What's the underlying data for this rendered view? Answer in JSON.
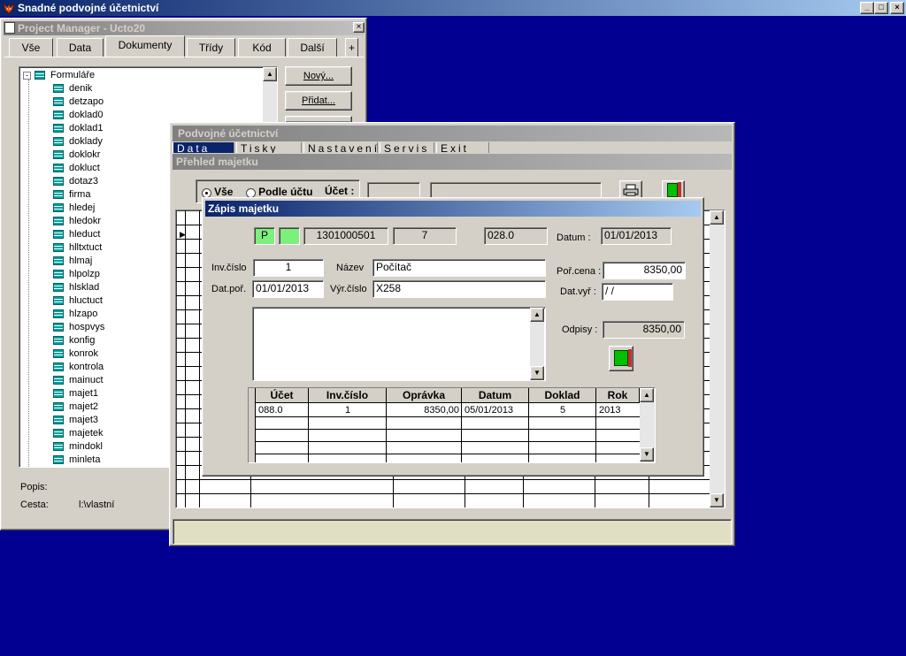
{
  "main_window": {
    "title": "Snadné podvojné účetnictví"
  },
  "project_manager": {
    "title": "Project Manager - Ucto20",
    "tabs": [
      "Vše",
      "Data",
      "Dokumenty",
      "Třídy",
      "Kód",
      "Další"
    ],
    "tab_more": "+",
    "tree_root": "Formuláře",
    "tree_items": [
      "denik",
      "detzapo",
      "doklad0",
      "doklad1",
      "doklady",
      "doklokr",
      "dokluct",
      "dotaz3",
      "firma",
      "hledej",
      "hledokr",
      "hleduct",
      "hlltxtuct",
      "hlmaj",
      "hlpolzp",
      "hlsklad",
      "hluctuct",
      "hlzapo",
      "hospvys",
      "konfig",
      "konrok",
      "kontrola",
      "mainuct",
      "majet1",
      "majet2",
      "majet3",
      "majetek",
      "mindokl",
      "minleta"
    ],
    "buttons": [
      "Nový...",
      "Přidat..."
    ],
    "popis_label": "Popis:",
    "cesta_label": "Cesta:",
    "cesta_value": "l:\\vlastní"
  },
  "podvojne": {
    "title": "Podvojné účetnictví",
    "menu": [
      "Data",
      "Tisky",
      "Nastavení",
      "Servis",
      "Exit"
    ]
  },
  "prehled": {
    "title": "Přehled majetku",
    "radio_all": "Vše",
    "radio_by_account": "Podle účtu",
    "ucet_label": "Účet :"
  },
  "zapis": {
    "title": "Zápis majetku",
    "flag_p": "P",
    "flag2": "",
    "code": "1301000501",
    "number": "7",
    "account": "028.0",
    "datum_label": "Datum :",
    "datum_value": "01/01/2013",
    "inv_label": "Inv.číslo",
    "inv_value": "1",
    "nazev_label": "Název",
    "nazev_value": "Počítač",
    "datpor_label": "Dat.poř.",
    "datpor_value": "01/01/2013",
    "vyr_label": "Výr.číslo",
    "vyr_value": "X258",
    "porcena_label": "Poř.cena :",
    "porcena_value": "8350,00",
    "datvyr_label": "Dat.vyř :",
    "datvyr_value": " / /",
    "odpisy_label": "Odpisy :",
    "odpisy_value": "8350,00",
    "table": {
      "headers": [
        "Účet",
        "Inv.číslo",
        "Oprávka",
        "Datum",
        "Doklad",
        "Rok"
      ],
      "rows": [
        [
          "088.0",
          "1",
          "8350,00",
          "05/01/2013",
          "5",
          "2013"
        ]
      ]
    }
  },
  "colors": {
    "desktop": "#020091",
    "active_title": "#0a246a",
    "field_green": "#7cf07c"
  }
}
